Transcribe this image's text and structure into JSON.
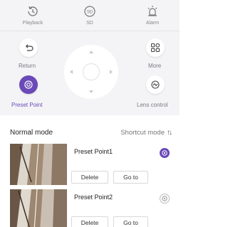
{
  "top_bar": {
    "items": [
      {
        "label": "Playback",
        "icon": "playback-icon"
      },
      {
        "label": "SD",
        "icon": "sd-card-icon"
      },
      {
        "label": "Alarm",
        "icon": "alarm-icon"
      }
    ]
  },
  "controls": {
    "return_label": "Return",
    "preset_label": "Preset Point",
    "more_label": "More",
    "lens_label": "Lens control",
    "accent_color": "#6a49b8"
  },
  "mode": {
    "title": "Normal mode",
    "switch_label": "Shortcut mode",
    "switch_icon": "sort-arrows-icon"
  },
  "presets": [
    {
      "name": "Preset Point1",
      "delete_label": "Delete",
      "goto_label": "Go to",
      "selected": true
    },
    {
      "name": "Preset Point2",
      "delete_label": "Delete",
      "goto_label": "Go to",
      "selected": false
    }
  ]
}
